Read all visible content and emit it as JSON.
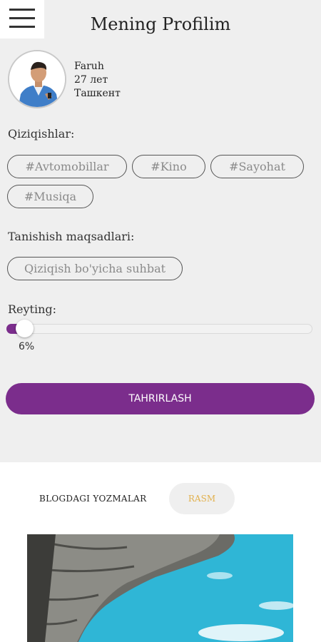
{
  "header": {
    "title": "Mening Profilim",
    "menu_icon": "hamburger-menu-icon"
  },
  "profile": {
    "name": "Faruh",
    "age": "27 лет",
    "city": "Ташкент"
  },
  "interests": {
    "label": "Qiziqishlar:",
    "tags": [
      "#Avtomobillar",
      "#Kino",
      "#Sayohat",
      "#Musiqa"
    ]
  },
  "goals": {
    "label": "Tanishish maqsadlari:",
    "items": [
      "Qiziqish bo'yicha suhbat"
    ]
  },
  "rating": {
    "label": "Reyting:",
    "value_text": "6%",
    "value": 0.06
  },
  "edit_button": {
    "label": "TAHRIRLASH"
  },
  "tabs": {
    "blog": "BLOGDAGI YOZMALAR",
    "photo": "RASM"
  },
  "colors": {
    "accent": "#7b2d8c",
    "active_tab_text": "#e2b14e",
    "background": "#efefef"
  }
}
